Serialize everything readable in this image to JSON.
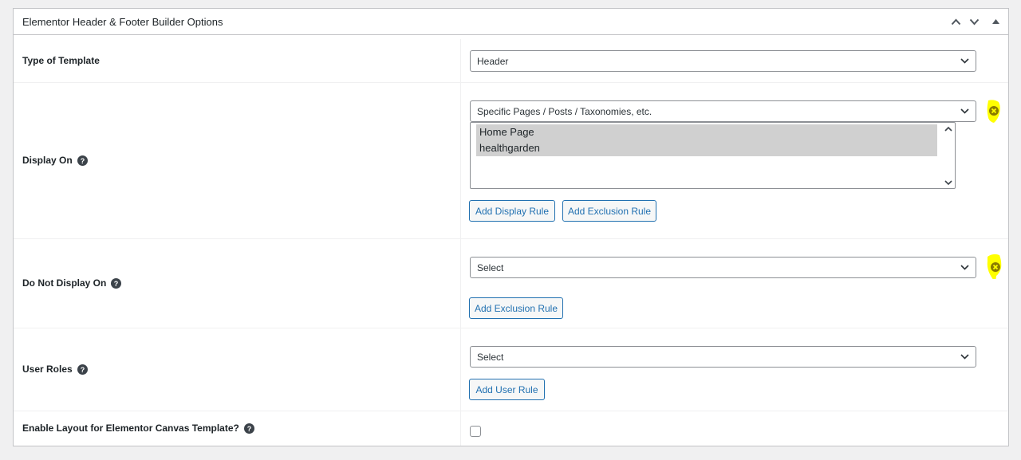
{
  "metabox": {
    "title": "Elementor Header & Footer Builder Options",
    "controls": {
      "up_icon": "chevron-up",
      "down_icon": "chevron-down",
      "toggle_icon": "triangle-up"
    }
  },
  "rows": {
    "type_of_template": {
      "label": "Type of Template",
      "select_value": "Header"
    },
    "display_on": {
      "label": "Display On",
      "select_value": "Specific Pages / Posts / Taxonomies, etc.",
      "selected_items": [
        "Home Page",
        "healthgarden"
      ],
      "add_display_rule": "Add Display Rule",
      "add_exclusion_rule": "Add Exclusion Rule"
    },
    "do_not_display_on": {
      "label": "Do Not Display On",
      "select_value": "Select",
      "add_exclusion_rule": "Add Exclusion Rule"
    },
    "user_roles": {
      "label": "User Roles",
      "select_value": "Select",
      "add_user_rule": "Add User Rule"
    },
    "canvas_template": {
      "label": "Enable Layout for Elementor Canvas Template?",
      "checked": false
    }
  },
  "colors": {
    "accent": "#2271b1",
    "highlight": "#ffff00",
    "remove_icon": "#8a7b00"
  }
}
